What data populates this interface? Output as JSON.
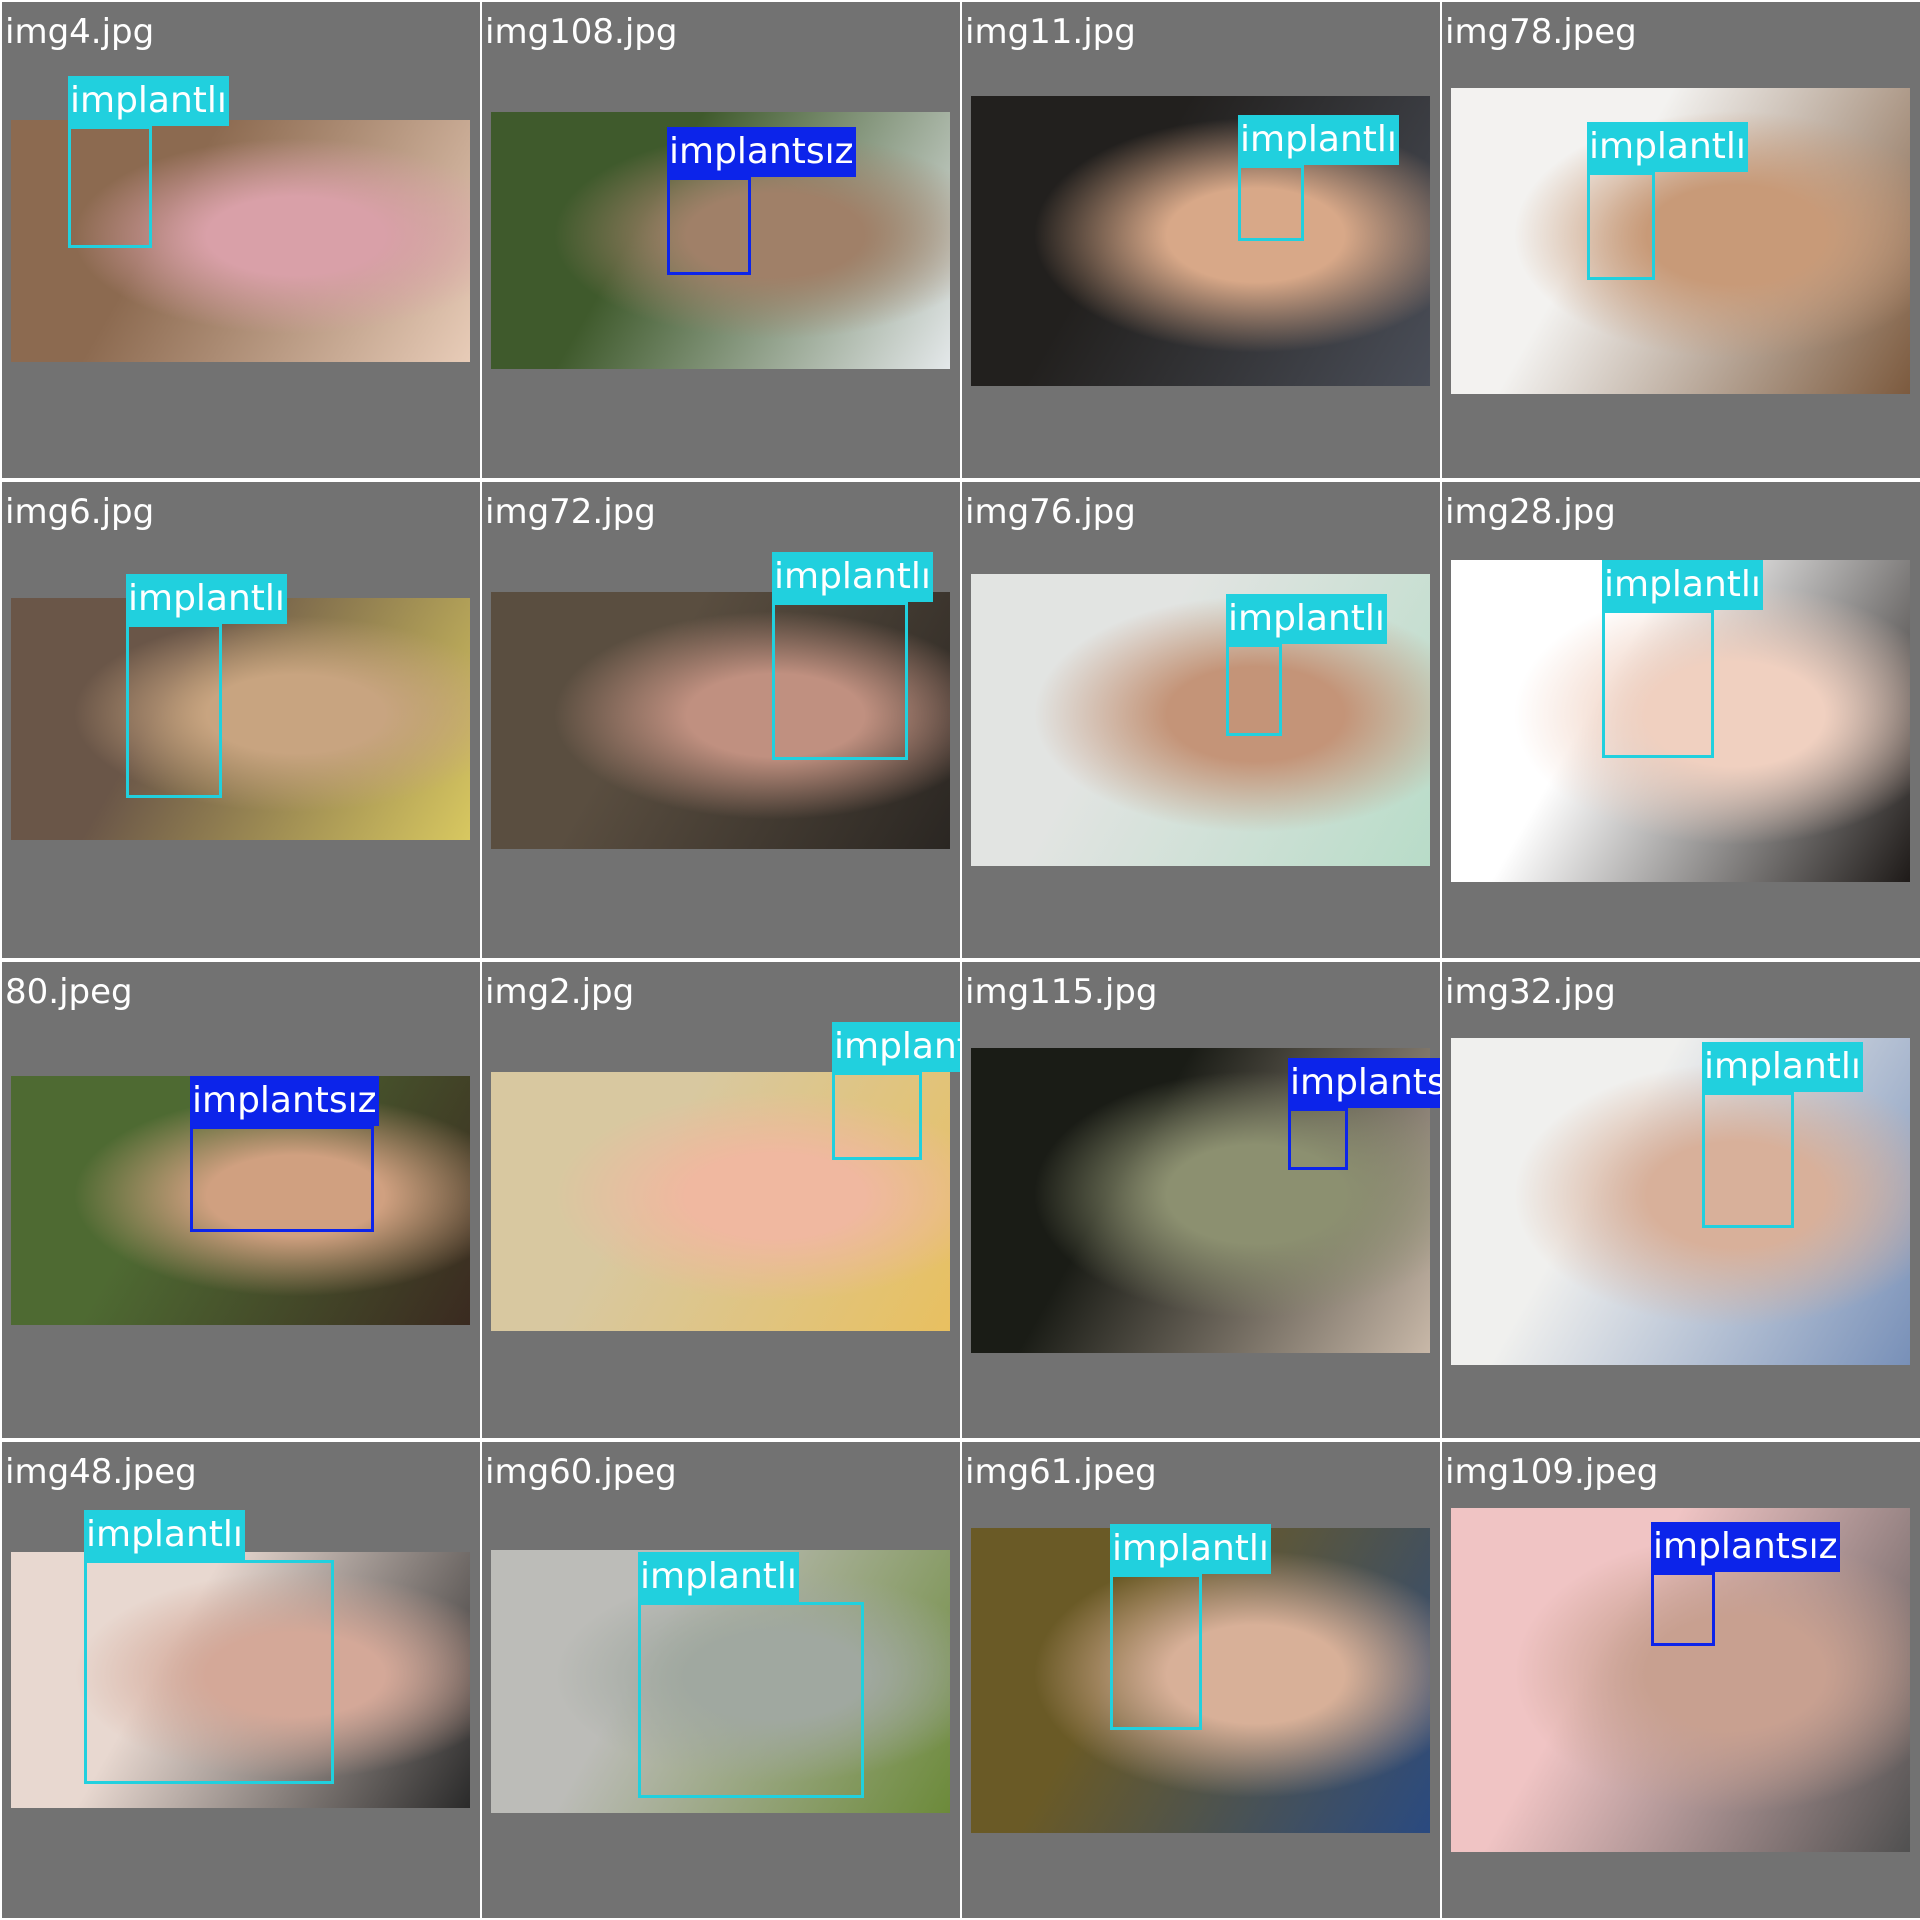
{
  "colors": {
    "implantli": "#21d0de",
    "implantsiz": "#0c24ea",
    "tile_background": "#727272",
    "filename_text": "#ffffff"
  },
  "tiles": [
    {
      "filename": "img4.jpg",
      "photo_colors": [
        "#8c6a50",
        "#d9a0a8",
        "#e8ccb8"
      ],
      "detections": [
        {
          "label": "implantlı",
          "class": "implantli"
        }
      ]
    },
    {
      "filename": "img108.jpg",
      "photo_colors": [
        "#3f5a2c",
        "#a08068",
        "#e4e8ea"
      ],
      "detections": [
        {
          "label": "implantsız",
          "class": "implantsiz"
        }
      ]
    },
    {
      "filename": "img11.jpg",
      "photo_colors": [
        "#22201e",
        "#d8a888",
        "#4a4e58"
      ],
      "detections": [
        {
          "label": "implantlı",
          "class": "implantli"
        }
      ]
    },
    {
      "filename": "img78.jpeg",
      "photo_colors": [
        "#f3f2f0",
        "#c89a78",
        "#7c5a3e"
      ],
      "detections": [
        {
          "label": "implantlı",
          "class": "implantli"
        }
      ]
    },
    {
      "filename": "img6.jpg",
      "photo_colors": [
        "#6a5648",
        "#c8a480",
        "#d8c860"
      ],
      "detections": [
        {
          "label": "implantlı",
          "class": "implantli"
        }
      ]
    },
    {
      "filename": "img72.jpg",
      "photo_colors": [
        "#5a4e40",
        "#c09080",
        "#2a2622"
      ],
      "detections": [
        {
          "label": "implantlı",
          "class": "implantli"
        }
      ]
    },
    {
      "filename": "img76.jpg",
      "photo_colors": [
        "#e2e4e2",
        "#c49478",
        "#b8dcc8"
      ],
      "detections": [
        {
          "label": "implantlı",
          "class": "implantli"
        }
      ]
    },
    {
      "filename": "img28.jpg",
      "photo_colors": [
        "#ffffff",
        "#f0d0c0",
        "#1e1a18"
      ],
      "detections": [
        {
          "label": "implantlı",
          "class": "implantli"
        }
      ]
    },
    {
      "filename": "80.jpeg",
      "photo_colors": [
        "#4e6a32",
        "#d0a080",
        "#3a2a20"
      ],
      "detections": [
        {
          "label": "implantsız",
          "class": "implantsiz"
        }
      ]
    },
    {
      "filename": "img2.jpg",
      "photo_colors": [
        "#d8c8a0",
        "#f0b8a0",
        "#e8c060"
      ],
      "detections": [
        {
          "label": "implantlı",
          "class": "implantli"
        }
      ]
    },
    {
      "filename": "img115.jpg",
      "photo_colors": [
        "#1a1c16",
        "#8c9070",
        "#c8b8a8"
      ],
      "detections": [
        {
          "label": "implantsız",
          "class": "implantsiz"
        }
      ]
    },
    {
      "filename": "img32.jpg",
      "photo_colors": [
        "#f0f0ee",
        "#d8b09a",
        "#7890b8"
      ],
      "detections": [
        {
          "label": "implantlı",
          "class": "implantli"
        }
      ]
    },
    {
      "filename": "img48.jpeg",
      "photo_colors": [
        "#e8d8d0",
        "#d4a898",
        "#2a2a2a"
      ],
      "detections": [
        {
          "label": "implantlı",
          "class": "implantli"
        }
      ]
    },
    {
      "filename": "img60.jpeg",
      "photo_colors": [
        "#bcbcb8",
        "#a0a8a0",
        "#6c8a3a"
      ],
      "detections": [
        {
          "label": "implantlı",
          "class": "implantli"
        }
      ]
    },
    {
      "filename": "img61.jpeg",
      "photo_colors": [
        "#6a5a26",
        "#d8b098",
        "#2a4a80"
      ],
      "detections": [
        {
          "label": "implantlı",
          "class": "implantli"
        }
      ]
    },
    {
      "filename": "img109.jpeg",
      "photo_colors": [
        "#f0c4c4",
        "#c8a090",
        "#505050"
      ],
      "detections": [
        {
          "label": "implantsız",
          "class": "implantsiz"
        }
      ]
    }
  ]
}
